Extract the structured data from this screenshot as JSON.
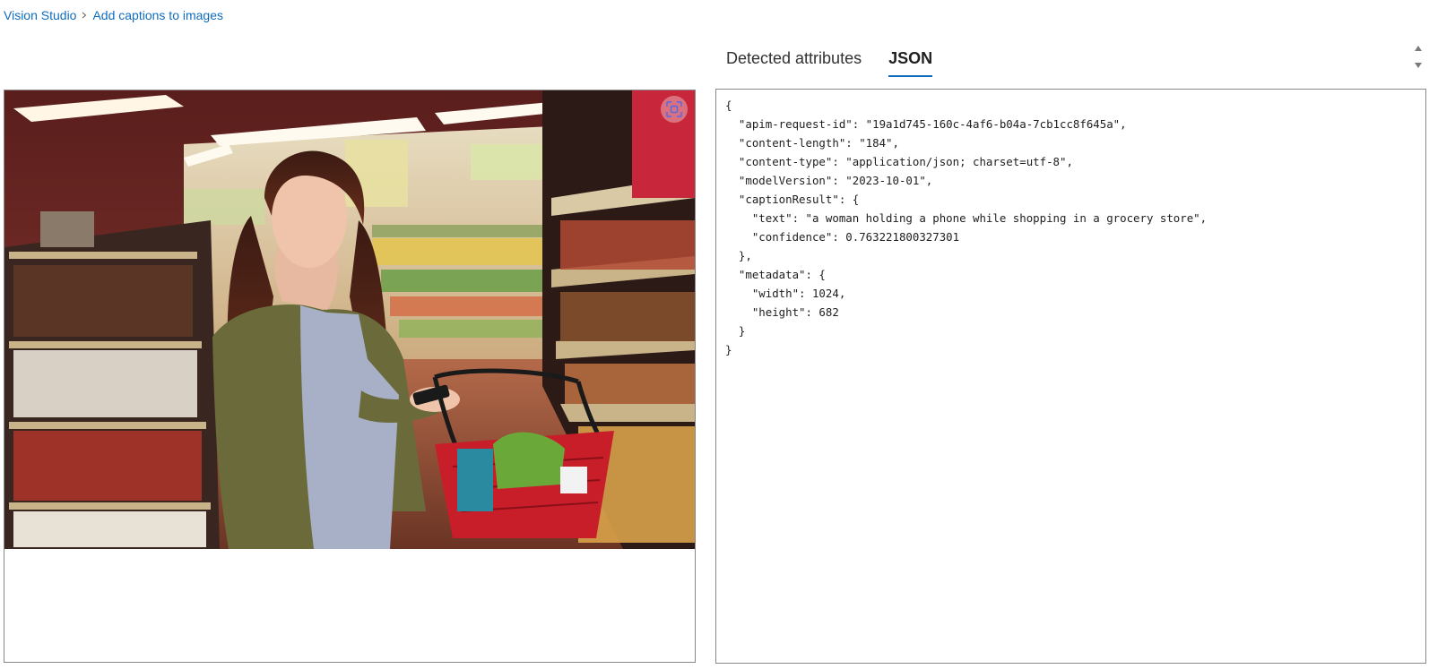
{
  "breadcrumb": {
    "items": [
      {
        "label": "Vision Studio"
      },
      {
        "label": "Add captions to images"
      }
    ]
  },
  "tabs": [
    {
      "label": "Detected attributes",
      "active": false
    },
    {
      "label": "JSON",
      "active": true
    }
  ],
  "image": {
    "alt": "a woman holding a phone while shopping in a grocery store",
    "detect_button_icon": "focus-scan-icon"
  },
  "json_output": {
    "text": "{\n  \"apim-request-id\": \"19a1d745-160c-4af6-b04a-7cb1cc8f645a\",\n  \"content-length\": \"184\",\n  \"content-type\": \"application/json; charset=utf-8\",\n  \"modelVersion\": \"2023-10-01\",\n  \"captionResult\": {\n    \"text\": \"a woman holding a phone while shopping in a grocery store\",\n    \"confidence\": 0.763221800327301\n  },\n  \"metadata\": {\n    \"width\": 1024,\n    \"height\": 682\n  }\n}"
  },
  "colors": {
    "accent": "#0f6cbd",
    "border": "#8a8886",
    "text": "#323130"
  }
}
